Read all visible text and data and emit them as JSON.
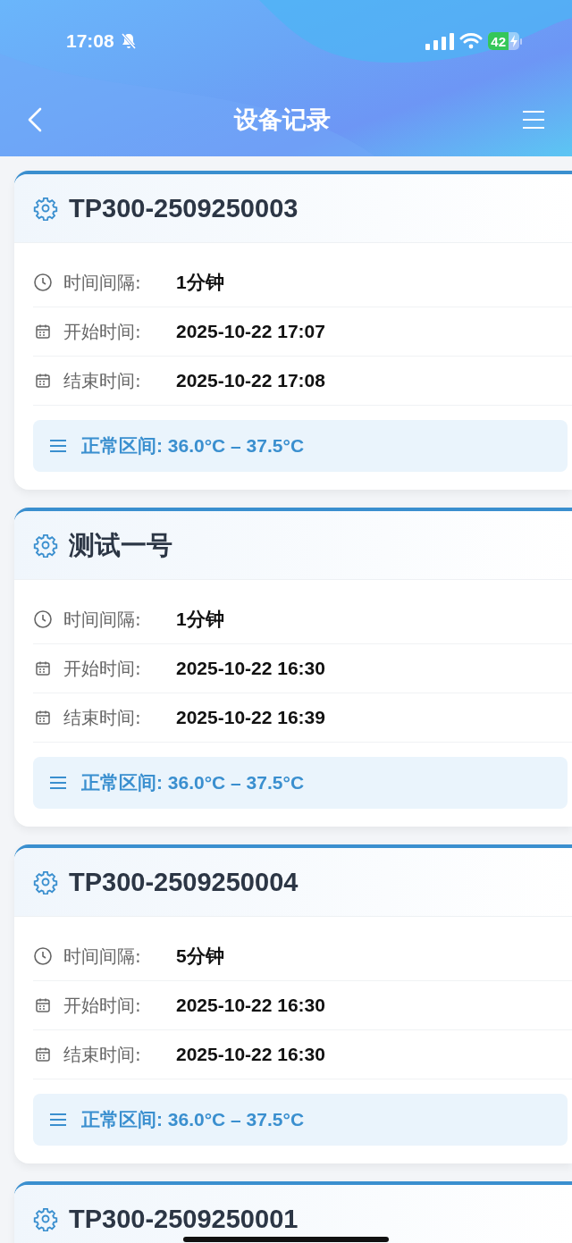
{
  "status_bar": {
    "time": "17:08",
    "battery": "42"
  },
  "nav": {
    "title": "设备记录"
  },
  "cards": [
    {
      "title": "TP300-2509250003",
      "rows": [
        {
          "kind": "duration",
          "label": "时间间隔:",
          "value": "1分钟"
        },
        {
          "kind": "date",
          "label": "开始时间:",
          "value": "2025-10-22 17:07"
        },
        {
          "kind": "date",
          "label": "结束时间:",
          "value": "2025-10-22 17:08"
        }
      ],
      "range": "正常区间: 36.0°C – 37.5°C"
    },
    {
      "title": "测试一号",
      "rows": [
        {
          "kind": "duration",
          "label": "时间间隔:",
          "value": "1分钟"
        },
        {
          "kind": "date",
          "label": "开始时间:",
          "value": "2025-10-22 16:30"
        },
        {
          "kind": "date",
          "label": "结束时间:",
          "value": "2025-10-22 16:39"
        }
      ],
      "range": "正常区间: 36.0°C – 37.5°C"
    },
    {
      "title": "TP300-2509250004",
      "rows": [
        {
          "kind": "duration",
          "label": "时间间隔:",
          "value": "5分钟"
        },
        {
          "kind": "date",
          "label": "开始时间:",
          "value": "2025-10-22 16:30"
        },
        {
          "kind": "date",
          "label": "结束时间:",
          "value": "2025-10-22 16:30"
        }
      ],
      "range": "正常区间: 36.0°C – 37.5°C"
    },
    {
      "title": "TP300-2509250001"
    }
  ]
}
